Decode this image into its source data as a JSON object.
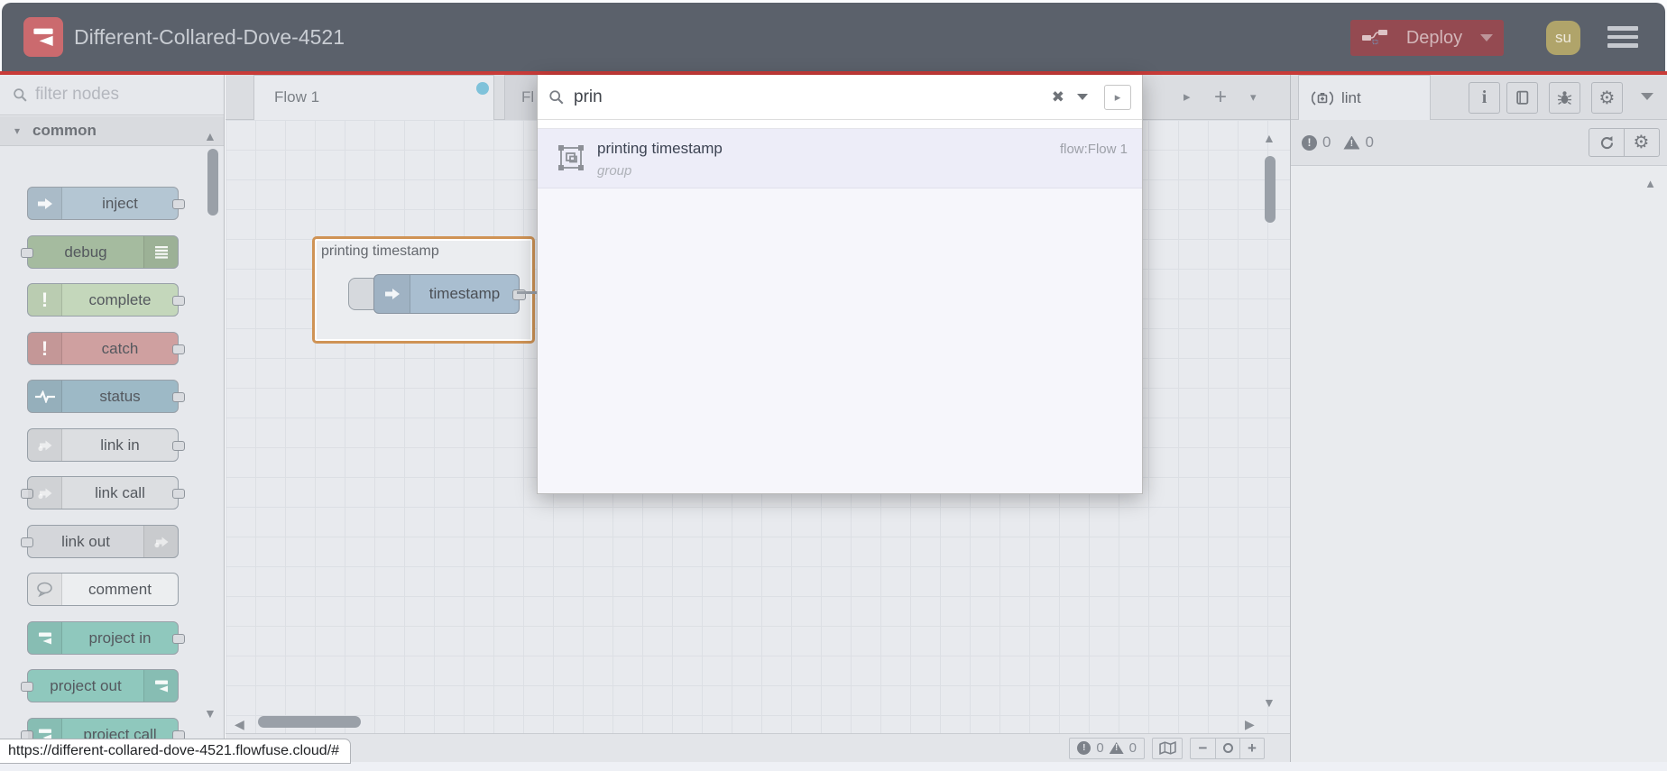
{
  "colors": {
    "header_bg": "#5b616b",
    "brand_red": "#cb6a6e",
    "deploy_red": "#944a51",
    "header_divider_red": "#c83b38",
    "dirty_dot_blue": "#7fc2da",
    "group_selected_orange": "#cf9355"
  },
  "header": {
    "title": "Different-Collared-Dove-4521",
    "deploy": {
      "label": "Deploy"
    },
    "avatar": "su"
  },
  "palette": {
    "filter_placeholder": "filter nodes",
    "category_label": "common",
    "nodes": [
      {
        "label": "inject",
        "color": "#b4c6d3",
        "icon": "arrow-right-icon",
        "icon_side": "left",
        "port_in": false,
        "port_out": true
      },
      {
        "label": "debug",
        "color": "#a5bb9f",
        "icon": "list-icon",
        "icon_side": "right",
        "port_in": true,
        "port_out": false
      },
      {
        "label": "complete",
        "color": "#c4d7bb",
        "icon": "exclaim-icon",
        "icon_side": "left",
        "port_in": false,
        "port_out": true
      },
      {
        "label": "catch",
        "color": "#cfa0a0",
        "icon": "exclaim-icon",
        "icon_side": "left",
        "port_in": false,
        "port_out": true
      },
      {
        "label": "status",
        "color": "#9db9c6",
        "icon": "pulse-icon",
        "icon_side": "left",
        "port_in": false,
        "port_out": true
      },
      {
        "label": "link in",
        "color": "#dcdee1",
        "icon": "link-icon",
        "icon_side": "left",
        "port_in": false,
        "port_out": true
      },
      {
        "label": "link call",
        "color": "#dcdee1",
        "icon": "link-icon",
        "icon_side": "left",
        "port_in": true,
        "port_out": true
      },
      {
        "label": "link out",
        "color": "#d4d6da",
        "icon": "link-icon",
        "icon_side": "right",
        "port_in": true,
        "port_out": false
      },
      {
        "label": "comment",
        "color": "#eceef0",
        "icon": "comment-icon",
        "icon_side": "left",
        "port_in": false,
        "port_out": false
      },
      {
        "label": "project in",
        "color": "#8fc8bd",
        "icon": "project-icon",
        "icon_side": "left",
        "port_in": false,
        "port_out": true
      },
      {
        "label": "project out",
        "color": "#8fc8bd",
        "icon": "project-icon",
        "icon_side": "right",
        "port_in": true,
        "port_out": false
      },
      {
        "label": "project call",
        "color": "#8fc8bd",
        "icon": "project-icon",
        "icon_side": "left",
        "port_in": true,
        "port_out": true
      }
    ]
  },
  "workspace": {
    "tabs": [
      {
        "label": "Flow 1",
        "active": true,
        "dirty": true
      },
      {
        "label": "Fl",
        "active": false
      }
    ],
    "group": {
      "label": "printing timestamp",
      "node": {
        "label": "timestamp"
      }
    },
    "footer": {
      "error_count": "0",
      "warning_count": "0"
    }
  },
  "search": {
    "query": "prin",
    "results": [
      {
        "title": "printing timestamp",
        "subtitle": "group",
        "meta": "flow:Flow 1"
      }
    ]
  },
  "sidebar": {
    "tab_label": "lint",
    "error_count": "0",
    "warning_count": "0"
  },
  "status_url": "https://different-collared-dove-4521.flowfuse.cloud/#"
}
